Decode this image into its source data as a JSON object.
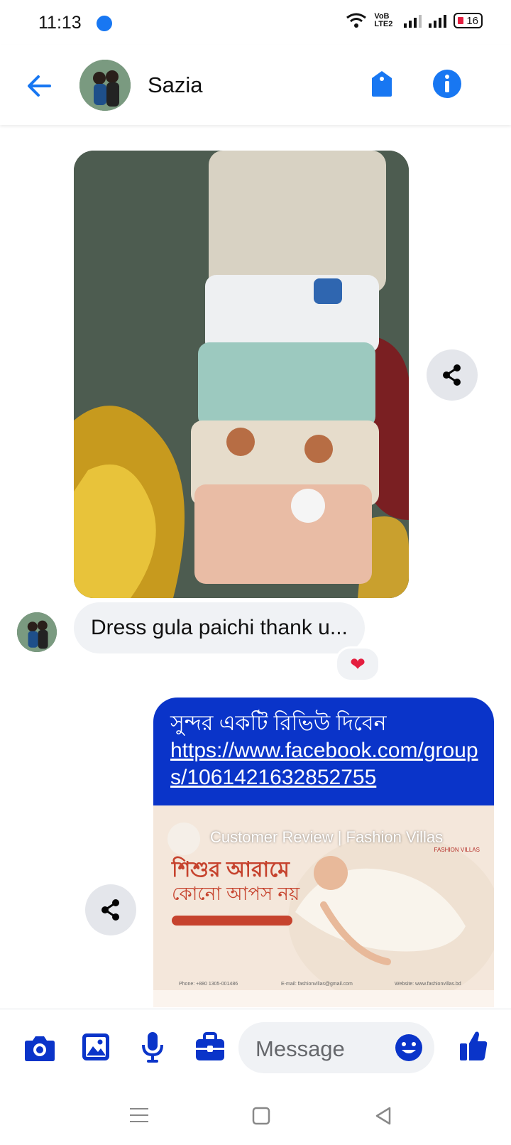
{
  "status_bar": {
    "time": "11:13",
    "network": "VoB LTE2",
    "battery": "16"
  },
  "header": {
    "contact_name": "Sazia"
  },
  "messages": {
    "incoming_text": "Dress gula paichi thank u...",
    "reaction": "❤",
    "outgoing_line1": "সুন্দর একটি রিভিউ দিবেন",
    "outgoing_link": "https://www.facebook.com/groups/1061421632852755",
    "preview_title": "Customer Review | Fashion Villas",
    "preview_headline": "শিশুর আরামে",
    "preview_subheadline": "কোনো আপস নয়",
    "preview_brand": "FASHION VILLAS",
    "preview_phone": "Phone: +880 1305-001486",
    "preview_email": "E-mail: fashionvillas@gmail.com",
    "preview_website": "Website: www.fashionvillas.bd"
  },
  "composer": {
    "placeholder": "Message"
  },
  "colors": {
    "accent": "#0a34c9",
    "messenger_blue": "#1877f2",
    "reaction_red": "#e41e3f"
  },
  "icons": [
    "back-arrow-icon",
    "tag-icon",
    "info-icon",
    "share-icon",
    "camera-icon",
    "gallery-icon",
    "microphone-icon",
    "briefcase-icon",
    "emoji-icon",
    "thumbs-up-icon",
    "menu-icon",
    "home-square-icon",
    "back-triangle-icon"
  ]
}
